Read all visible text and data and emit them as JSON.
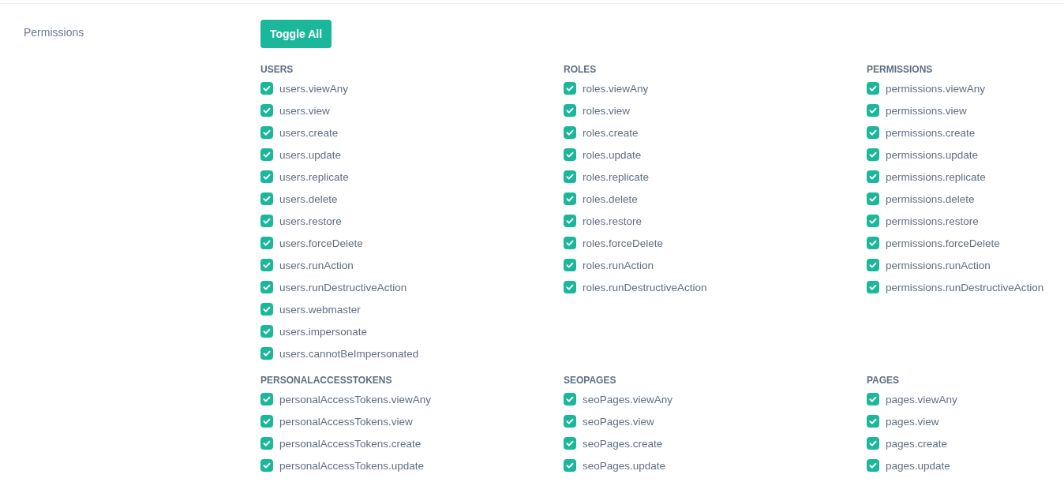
{
  "field_label": "Permissions",
  "toggle_button": "Toggle All",
  "groups": [
    {
      "heading": "USERS",
      "items": [
        {
          "label": "users.viewAny",
          "checked": true
        },
        {
          "label": "users.view",
          "checked": true
        },
        {
          "label": "users.create",
          "checked": true
        },
        {
          "label": "users.update",
          "checked": true
        },
        {
          "label": "users.replicate",
          "checked": true
        },
        {
          "label": "users.delete",
          "checked": true
        },
        {
          "label": "users.restore",
          "checked": true
        },
        {
          "label": "users.forceDelete",
          "checked": true
        },
        {
          "label": "users.runAction",
          "checked": true
        },
        {
          "label": "users.runDestructiveAction",
          "checked": true
        },
        {
          "label": "users.webmaster",
          "checked": true
        },
        {
          "label": "users.impersonate",
          "checked": true
        },
        {
          "label": "users.cannotBeImpersonated",
          "checked": true
        }
      ]
    },
    {
      "heading": "ROLES",
      "items": [
        {
          "label": "roles.viewAny",
          "checked": true
        },
        {
          "label": "roles.view",
          "checked": true
        },
        {
          "label": "roles.create",
          "checked": true
        },
        {
          "label": "roles.update",
          "checked": true
        },
        {
          "label": "roles.replicate",
          "checked": true
        },
        {
          "label": "roles.delete",
          "checked": true
        },
        {
          "label": "roles.restore",
          "checked": true
        },
        {
          "label": "roles.forceDelete",
          "checked": true
        },
        {
          "label": "roles.runAction",
          "checked": true
        },
        {
          "label": "roles.runDestructiveAction",
          "checked": true
        }
      ]
    },
    {
      "heading": "PERMISSIONS",
      "items": [
        {
          "label": "permissions.viewAny",
          "checked": true
        },
        {
          "label": "permissions.view",
          "checked": true
        },
        {
          "label": "permissions.create",
          "checked": true
        },
        {
          "label": "permissions.update",
          "checked": true
        },
        {
          "label": "permissions.replicate",
          "checked": true
        },
        {
          "label": "permissions.delete",
          "checked": true
        },
        {
          "label": "permissions.restore",
          "checked": true
        },
        {
          "label": "permissions.forceDelete",
          "checked": true
        },
        {
          "label": "permissions.runAction",
          "checked": true
        },
        {
          "label": "permissions.runDestructiveAction",
          "checked": true
        }
      ]
    },
    {
      "heading": "PERSONALACCESSTOKENS",
      "items": [
        {
          "label": "personalAccessTokens.viewAny",
          "checked": true
        },
        {
          "label": "personalAccessTokens.view",
          "checked": true
        },
        {
          "label": "personalAccessTokens.create",
          "checked": true
        },
        {
          "label": "personalAccessTokens.update",
          "checked": true
        }
      ]
    },
    {
      "heading": "SEOPAGES",
      "items": [
        {
          "label": "seoPages.viewAny",
          "checked": true
        },
        {
          "label": "seoPages.view",
          "checked": true
        },
        {
          "label": "seoPages.create",
          "checked": true
        },
        {
          "label": "seoPages.update",
          "checked": true
        }
      ]
    },
    {
      "heading": "PAGES",
      "items": [
        {
          "label": "pages.viewAny",
          "checked": true
        },
        {
          "label": "pages.view",
          "checked": true
        },
        {
          "label": "pages.create",
          "checked": true
        },
        {
          "label": "pages.update",
          "checked": true
        }
      ]
    }
  ]
}
